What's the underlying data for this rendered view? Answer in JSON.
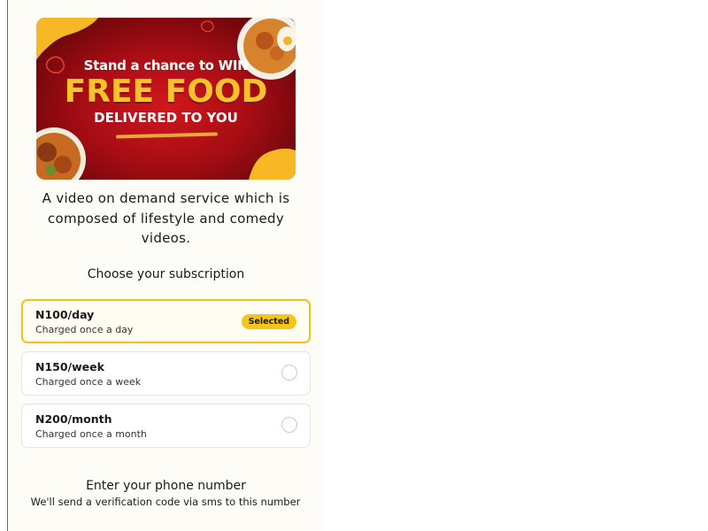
{
  "banner": {
    "line1": "Stand a chance to WIN",
    "line2": "FREE FOOD",
    "line3": "DELIVERED TO YOU"
  },
  "description": "A video on demand service which is composed of lifestyle and comedy videos.",
  "subscription": {
    "heading": "Choose your subscription",
    "plans": [
      {
        "price": "N100/day",
        "note": "Charged once a day",
        "selected": true,
        "badge": "Selected"
      },
      {
        "price": "N150/week",
        "note": "Charged once a week",
        "selected": false
      },
      {
        "price": "N200/month",
        "note": "Charged once a month",
        "selected": false
      }
    ]
  },
  "phone": {
    "title": "Enter your phone number",
    "subtitle": "We'll send a verification code via sms to this number"
  },
  "colors": {
    "accent": "#f5c518",
    "banner_red": "#c2121a",
    "panel_bg": "#fefcf6"
  }
}
